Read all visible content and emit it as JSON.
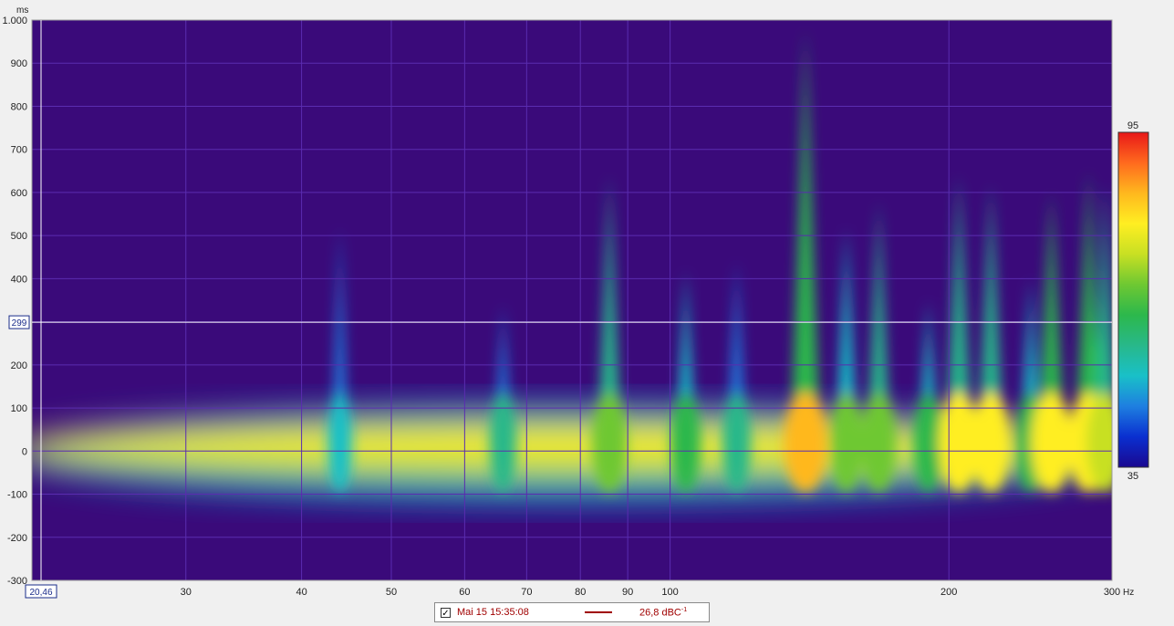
{
  "chart_data": {
    "type": "heatmap",
    "title": "",
    "x_unit": "Hz",
    "y_unit": "ms",
    "x_scale": "log",
    "xlim": [
      20.46,
      300
    ],
    "ylim": [
      -300,
      1000
    ],
    "x_ticks": [
      {
        "value": 30,
        "label": "30"
      },
      {
        "value": 40,
        "label": "40"
      },
      {
        "value": 50,
        "label": "50"
      },
      {
        "value": 60,
        "label": "60"
      },
      {
        "value": 70,
        "label": "70"
      },
      {
        "value": 80,
        "label": "80"
      },
      {
        "value": 90,
        "label": "90"
      },
      {
        "value": 100,
        "label": "100"
      },
      {
        "value": 200,
        "label": "200"
      },
      {
        "value": 300,
        "label": "300"
      }
    ],
    "y_ticks": [
      {
        "value": 1000,
        "label": "1.000"
      },
      {
        "value": 900,
        "label": "900"
      },
      {
        "value": 800,
        "label": "800"
      },
      {
        "value": 700,
        "label": "700"
      },
      {
        "value": 600,
        "label": "600"
      },
      {
        "value": 500,
        "label": "500"
      },
      {
        "value": 400,
        "label": "400"
      },
      {
        "value": 300,
        "label": ""
      },
      {
        "value": 200,
        "label": "200"
      },
      {
        "value": 100,
        "label": "100"
      },
      {
        "value": 0,
        "label": "0"
      },
      {
        "value": -100,
        "label": "-100"
      },
      {
        "value": -200,
        "label": "-200"
      },
      {
        "value": -300,
        "label": "-300"
      }
    ],
    "grid": true,
    "color_scale": {
      "min": 35,
      "max": 95,
      "min_label": "35",
      "max_label": "95"
    },
    "cursor": {
      "x": 20.46,
      "y": 299,
      "x_label": "20,46",
      "y_label": "299"
    },
    "peaks": [
      {
        "freq": 44,
        "time": 520,
        "level": 50
      },
      {
        "freq": 66,
        "time": 340,
        "level": 55
      },
      {
        "freq": 86,
        "time": 640,
        "level": 70
      },
      {
        "freq": 104,
        "time": 420,
        "level": 60
      },
      {
        "freq": 118,
        "time": 440,
        "level": 58
      },
      {
        "freq": 140,
        "time": 980,
        "level": 85
      },
      {
        "freq": 155,
        "time": 520,
        "level": 65
      },
      {
        "freq": 168,
        "time": 580,
        "level": 70
      },
      {
        "freq": 190,
        "time": 350,
        "level": 60
      },
      {
        "freq": 205,
        "time": 640,
        "level": 78
      },
      {
        "freq": 222,
        "time": 620,
        "level": 76
      },
      {
        "freq": 245,
        "time": 400,
        "level": 62
      },
      {
        "freq": 258,
        "time": 600,
        "level": 80
      },
      {
        "freq": 283,
        "time": 650,
        "level": 80
      },
      {
        "freq": 295,
        "time": 620,
        "level": 75
      }
    ],
    "colors": {
      "plot_background": "#3a0a7a",
      "grid": "#5a2cb0",
      "cursor": "#ffffff"
    },
    "colormap": [
      "#1a0890",
      "#0a2fd0",
      "#1e7fe0",
      "#19c0c8",
      "#28b88a",
      "#2cb84c",
      "#6ec832",
      "#c8e023",
      "#ffee22",
      "#ffb81e",
      "#ff6a1e",
      "#e81818"
    ]
  },
  "legend": {
    "checked": true,
    "check_glyph": "✓",
    "name": "Mai 15 15:35:08",
    "value": "26,8 dBC",
    "value_sup": "-1"
  }
}
